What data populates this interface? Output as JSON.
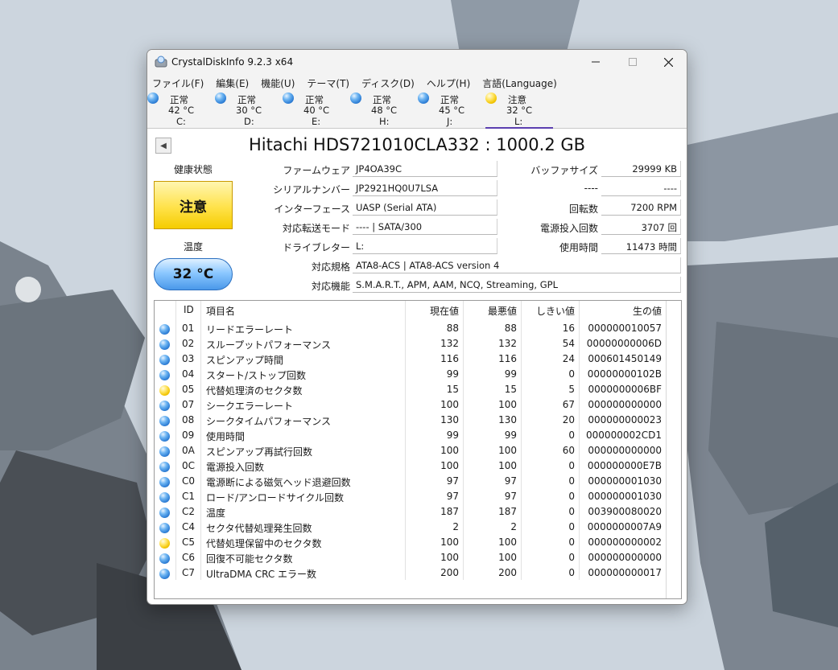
{
  "window": {
    "title": "CrystalDiskInfo 9.2.3 x64"
  },
  "menu": [
    "ファイル(F)",
    "編集(E)",
    "機能(U)",
    "テーマ(T)",
    "ディスク(D)",
    "ヘルプ(H)",
    "言語(Language)"
  ],
  "drives": [
    {
      "status": "正常",
      "temp": "42 °C",
      "letter": "C:",
      "level": "good"
    },
    {
      "status": "正常",
      "temp": "30 °C",
      "letter": "D:",
      "level": "good"
    },
    {
      "status": "正常",
      "temp": "40 °C",
      "letter": "E:",
      "level": "good"
    },
    {
      "status": "正常",
      "temp": "48 °C",
      "letter": "H:",
      "level": "good"
    },
    {
      "status": "正常",
      "temp": "45 °C",
      "letter": "J:",
      "level": "good"
    },
    {
      "status": "注意",
      "temp": "32 °C",
      "letter": "L:",
      "level": "caution"
    }
  ],
  "disk": {
    "model": "Hitachi HDS721010CLA332 : 1000.2 GB",
    "health_label": "健康状態",
    "health_value": "注意",
    "temp_label": "温度",
    "temp_value": "32 °C",
    "firmware_label": "ファームウェア",
    "firmware": "JP4OA39C",
    "serial_label": "シリアルナンバー",
    "serial": "JP2921HQ0U7LSA",
    "interface_label": "インターフェース",
    "interface": "UASP (Serial ATA)",
    "transfer_label": "対応転送モード",
    "transfer": "---- | SATA/300",
    "drive_letter_label": "ドライブレター",
    "drive_letter": "L:",
    "standard_label": "対応規格",
    "standard": "ATA8-ACS | ATA8-ACS version 4",
    "features_label": "対応機能",
    "features": "S.M.A.R.T., APM, AAM, NCQ, Streaming, GPL",
    "buffer_label": "バッファサイズ",
    "buffer": "29999 KB",
    "blank_label": "----",
    "blank_value": "----",
    "rotation_label": "回転数",
    "rotation": "7200 RPM",
    "power_count_label": "電源投入回数",
    "power_count": "3707 回",
    "power_hours_label": "使用時間",
    "power_hours": "11473 時間"
  },
  "smart": {
    "headers": [
      "ID",
      "項目名",
      "現在値",
      "最悪値",
      "しきい値",
      "生の値"
    ],
    "rows": [
      {
        "level": "good",
        "id": "01",
        "name": "リードエラーレート",
        "current": "88",
        "worst": "88",
        "threshold": "16",
        "raw": "000000010057"
      },
      {
        "level": "good",
        "id": "02",
        "name": "スループットパフォーマンス",
        "current": "132",
        "worst": "132",
        "threshold": "54",
        "raw": "00000000006D"
      },
      {
        "level": "good",
        "id": "03",
        "name": "スピンアップ時間",
        "current": "116",
        "worst": "116",
        "threshold": "24",
        "raw": "000601450149"
      },
      {
        "level": "good",
        "id": "04",
        "name": "スタート/ストップ回数",
        "current": "99",
        "worst": "99",
        "threshold": "0",
        "raw": "00000000102B"
      },
      {
        "level": "caution",
        "id": "05",
        "name": "代替処理済のセクタ数",
        "current": "15",
        "worst": "15",
        "threshold": "5",
        "raw": "0000000006BF"
      },
      {
        "level": "good",
        "id": "07",
        "name": "シークエラーレート",
        "current": "100",
        "worst": "100",
        "threshold": "67",
        "raw": "000000000000"
      },
      {
        "level": "good",
        "id": "08",
        "name": "シークタイムパフォーマンス",
        "current": "130",
        "worst": "130",
        "threshold": "20",
        "raw": "000000000023"
      },
      {
        "level": "good",
        "id": "09",
        "name": "使用時間",
        "current": "99",
        "worst": "99",
        "threshold": "0",
        "raw": "000000002CD1"
      },
      {
        "level": "good",
        "id": "0A",
        "name": "スピンアップ再試行回数",
        "current": "100",
        "worst": "100",
        "threshold": "60",
        "raw": "000000000000"
      },
      {
        "level": "good",
        "id": "0C",
        "name": "電源投入回数",
        "current": "100",
        "worst": "100",
        "threshold": "0",
        "raw": "000000000E7B"
      },
      {
        "level": "good",
        "id": "C0",
        "name": "電源断による磁気ヘッド退避回数",
        "current": "97",
        "worst": "97",
        "threshold": "0",
        "raw": "000000001030"
      },
      {
        "level": "good",
        "id": "C1",
        "name": "ロード/アンロードサイクル回数",
        "current": "97",
        "worst": "97",
        "threshold": "0",
        "raw": "000000001030"
      },
      {
        "level": "good",
        "id": "C2",
        "name": "温度",
        "current": "187",
        "worst": "187",
        "threshold": "0",
        "raw": "003900080020"
      },
      {
        "level": "good",
        "id": "C4",
        "name": "セクタ代替処理発生回数",
        "current": "2",
        "worst": "2",
        "threshold": "0",
        "raw": "0000000007A9"
      },
      {
        "level": "caution",
        "id": "C5",
        "name": "代替処理保留中のセクタ数",
        "current": "100",
        "worst": "100",
        "threshold": "0",
        "raw": "000000000002"
      },
      {
        "level": "good",
        "id": "C6",
        "name": "回復不可能セクタ数",
        "current": "100",
        "worst": "100",
        "threshold": "0",
        "raw": "000000000000"
      },
      {
        "level": "good",
        "id": "C7",
        "name": "UltraDMA CRC エラー数",
        "current": "200",
        "worst": "200",
        "threshold": "0",
        "raw": "000000000017"
      }
    ]
  },
  "colors": {
    "good": "#3a8ee6",
    "caution": "#f5cc00",
    "accent": "#5b3fb0"
  }
}
